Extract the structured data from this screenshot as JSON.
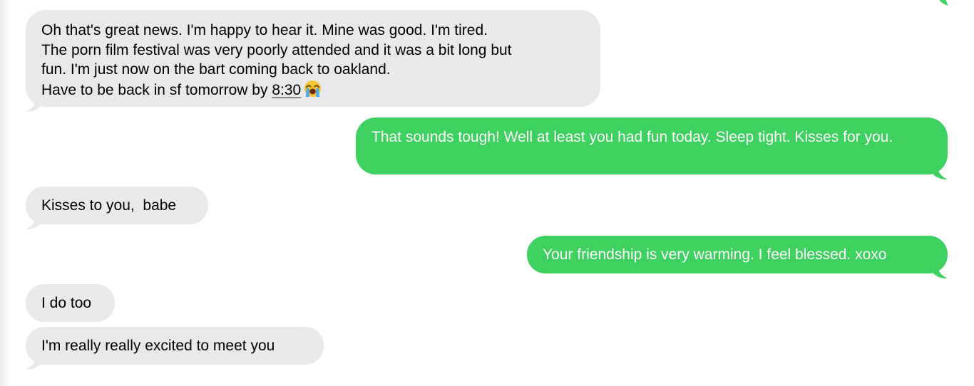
{
  "colors": {
    "received_bubble": "#e9e9eb",
    "sent_bubble": "#3fd160",
    "received_text": "#000000",
    "sent_text": "#ffffff"
  },
  "icons": {
    "cry_emoji": "loudly-crying-face"
  },
  "messages": [
    {
      "direction": "received",
      "lines": [
        "Oh that's great news. I'm happy to hear it. Mine was good. I'm tired.",
        "The porn film festival was very poorly attended and it was a bit long but",
        "fun. I'm just now on the bart coming back to oakland.",
        "Have to be back in sf tomorrow by"
      ],
      "time_link": "8:30"
    },
    {
      "direction": "sent",
      "text": "That sounds tough! Well at least you had fun today. Sleep tight. Kisses for you."
    },
    {
      "direction": "received",
      "text": "Kisses to you,  babe"
    },
    {
      "direction": "sent",
      "text": "Your friendship is very warming. I feel blessed. xoxo"
    },
    {
      "direction": "received",
      "text": "I do too"
    },
    {
      "direction": "received",
      "text": "I'm really really excited to meet you"
    }
  ]
}
